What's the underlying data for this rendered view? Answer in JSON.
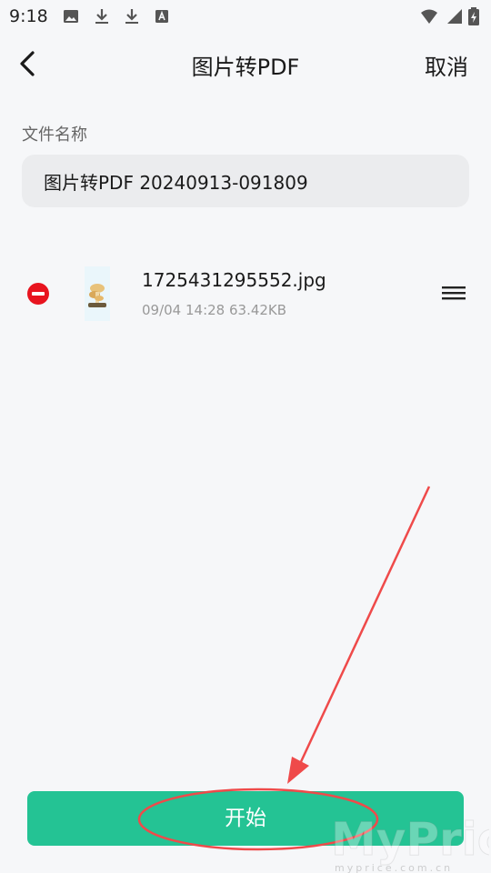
{
  "status_bar": {
    "time": "9:18",
    "left_icons": [
      "image-icon",
      "download-icon",
      "download-icon",
      "text-box-icon"
    ],
    "right_icons": [
      "wifi-icon",
      "signal-icon",
      "battery-charging-icon"
    ]
  },
  "header": {
    "back_icon": "chevron-left-icon",
    "title": "图片转PDF",
    "cancel_label": "取消"
  },
  "form": {
    "file_name_label": "文件名称",
    "file_name_value": "图片转PDF 20240913-091809"
  },
  "files": [
    {
      "name": "1725431295552.jpg",
      "meta": "09/04 14:28 63.42KB",
      "remove_icon": "remove-circle-icon",
      "drag_icon": "drag-handle-icon"
    }
  ],
  "start_label": "开始",
  "colors": {
    "accent": "#24c394",
    "remove": "#e8141f",
    "annotation": "#ef4a4a",
    "background": "#f6f7f9",
    "input_background": "#ebecee"
  }
}
